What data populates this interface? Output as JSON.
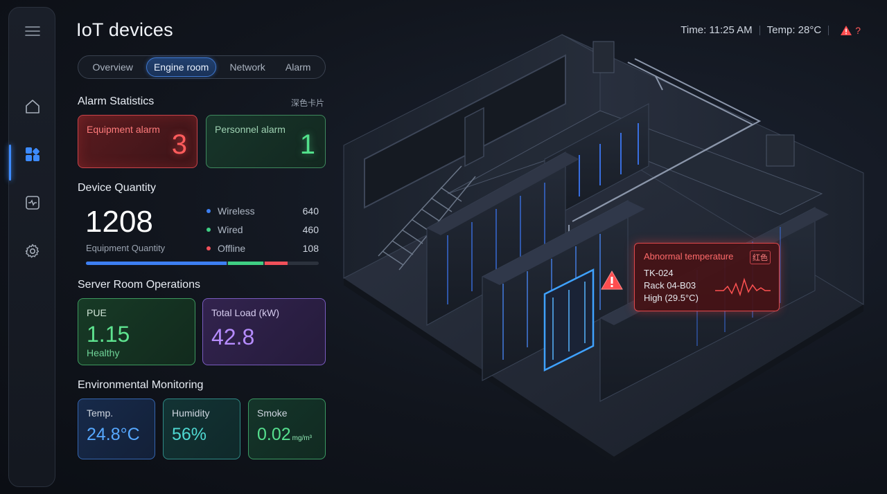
{
  "page": {
    "title": "IoT devices"
  },
  "header": {
    "time": "Time: 11:25 AM",
    "temp": "Temp: 28°C",
    "alert_text": "?"
  },
  "sidebar": {
    "items": [
      {
        "name": "menu-icon"
      },
      {
        "name": "home-icon"
      },
      {
        "name": "dashboard-icon"
      },
      {
        "name": "monitor-icon"
      },
      {
        "name": "settings-icon"
      }
    ],
    "active": "dashboard-icon"
  },
  "tabs": [
    {
      "label": "Overview",
      "active": false
    },
    {
      "label": "Engine room",
      "active": true
    },
    {
      "label": "Network",
      "active": false
    },
    {
      "label": "Alarm",
      "active": false
    }
  ],
  "alarm_stats": {
    "title": "Alarm Statistics",
    "aside": "深色卡片",
    "equipment": {
      "label": "Equipment alarm",
      "value": "3"
    },
    "personnel": {
      "label": "Personnel alarm",
      "value": "1"
    }
  },
  "device_quantity": {
    "title": "Device Quantity",
    "total": "1208",
    "total_label": "Equipment Quantity",
    "legend": [
      {
        "label": "Wireless",
        "value": "640",
        "color": "#3d7ff2"
      },
      {
        "label": "Wired",
        "value": "460",
        "color": "#3fcf83"
      },
      {
        "label": "Offline",
        "value": "108",
        "color": "#f0505a"
      }
    ],
    "progress": [
      {
        "fraction": 0.605,
        "color": "#3d7ff2"
      },
      {
        "fraction": 0.15,
        "color": "#3fcf83"
      },
      {
        "fraction": 0.1,
        "color": "#f0505a"
      }
    ]
  },
  "server_ops": {
    "title": "Server Room Operations",
    "pue": {
      "label": "PUE",
      "value": "1.15",
      "status": "Healthy"
    },
    "load": {
      "label": "Total Load (kW)",
      "value": "42.8"
    }
  },
  "env": {
    "title": "Environmental Monitoring",
    "temp": {
      "label": "Temp.",
      "value": "24.8°C"
    },
    "humidity": {
      "label": "Humidity",
      "value": "56%"
    },
    "smoke": {
      "label": "Smoke",
      "value": "0.02",
      "unit": "mg/m³"
    }
  },
  "popup": {
    "title": "Abnormal temperature",
    "tag": "红色",
    "device": "TK-024",
    "rack": "Rack 04-B03",
    "level": "High (29.5°C)"
  },
  "colors": {
    "accent": "#3d8bff",
    "alarm": "#ff5c5c",
    "ok": "#52e08b",
    "purple": "#b68cff"
  }
}
